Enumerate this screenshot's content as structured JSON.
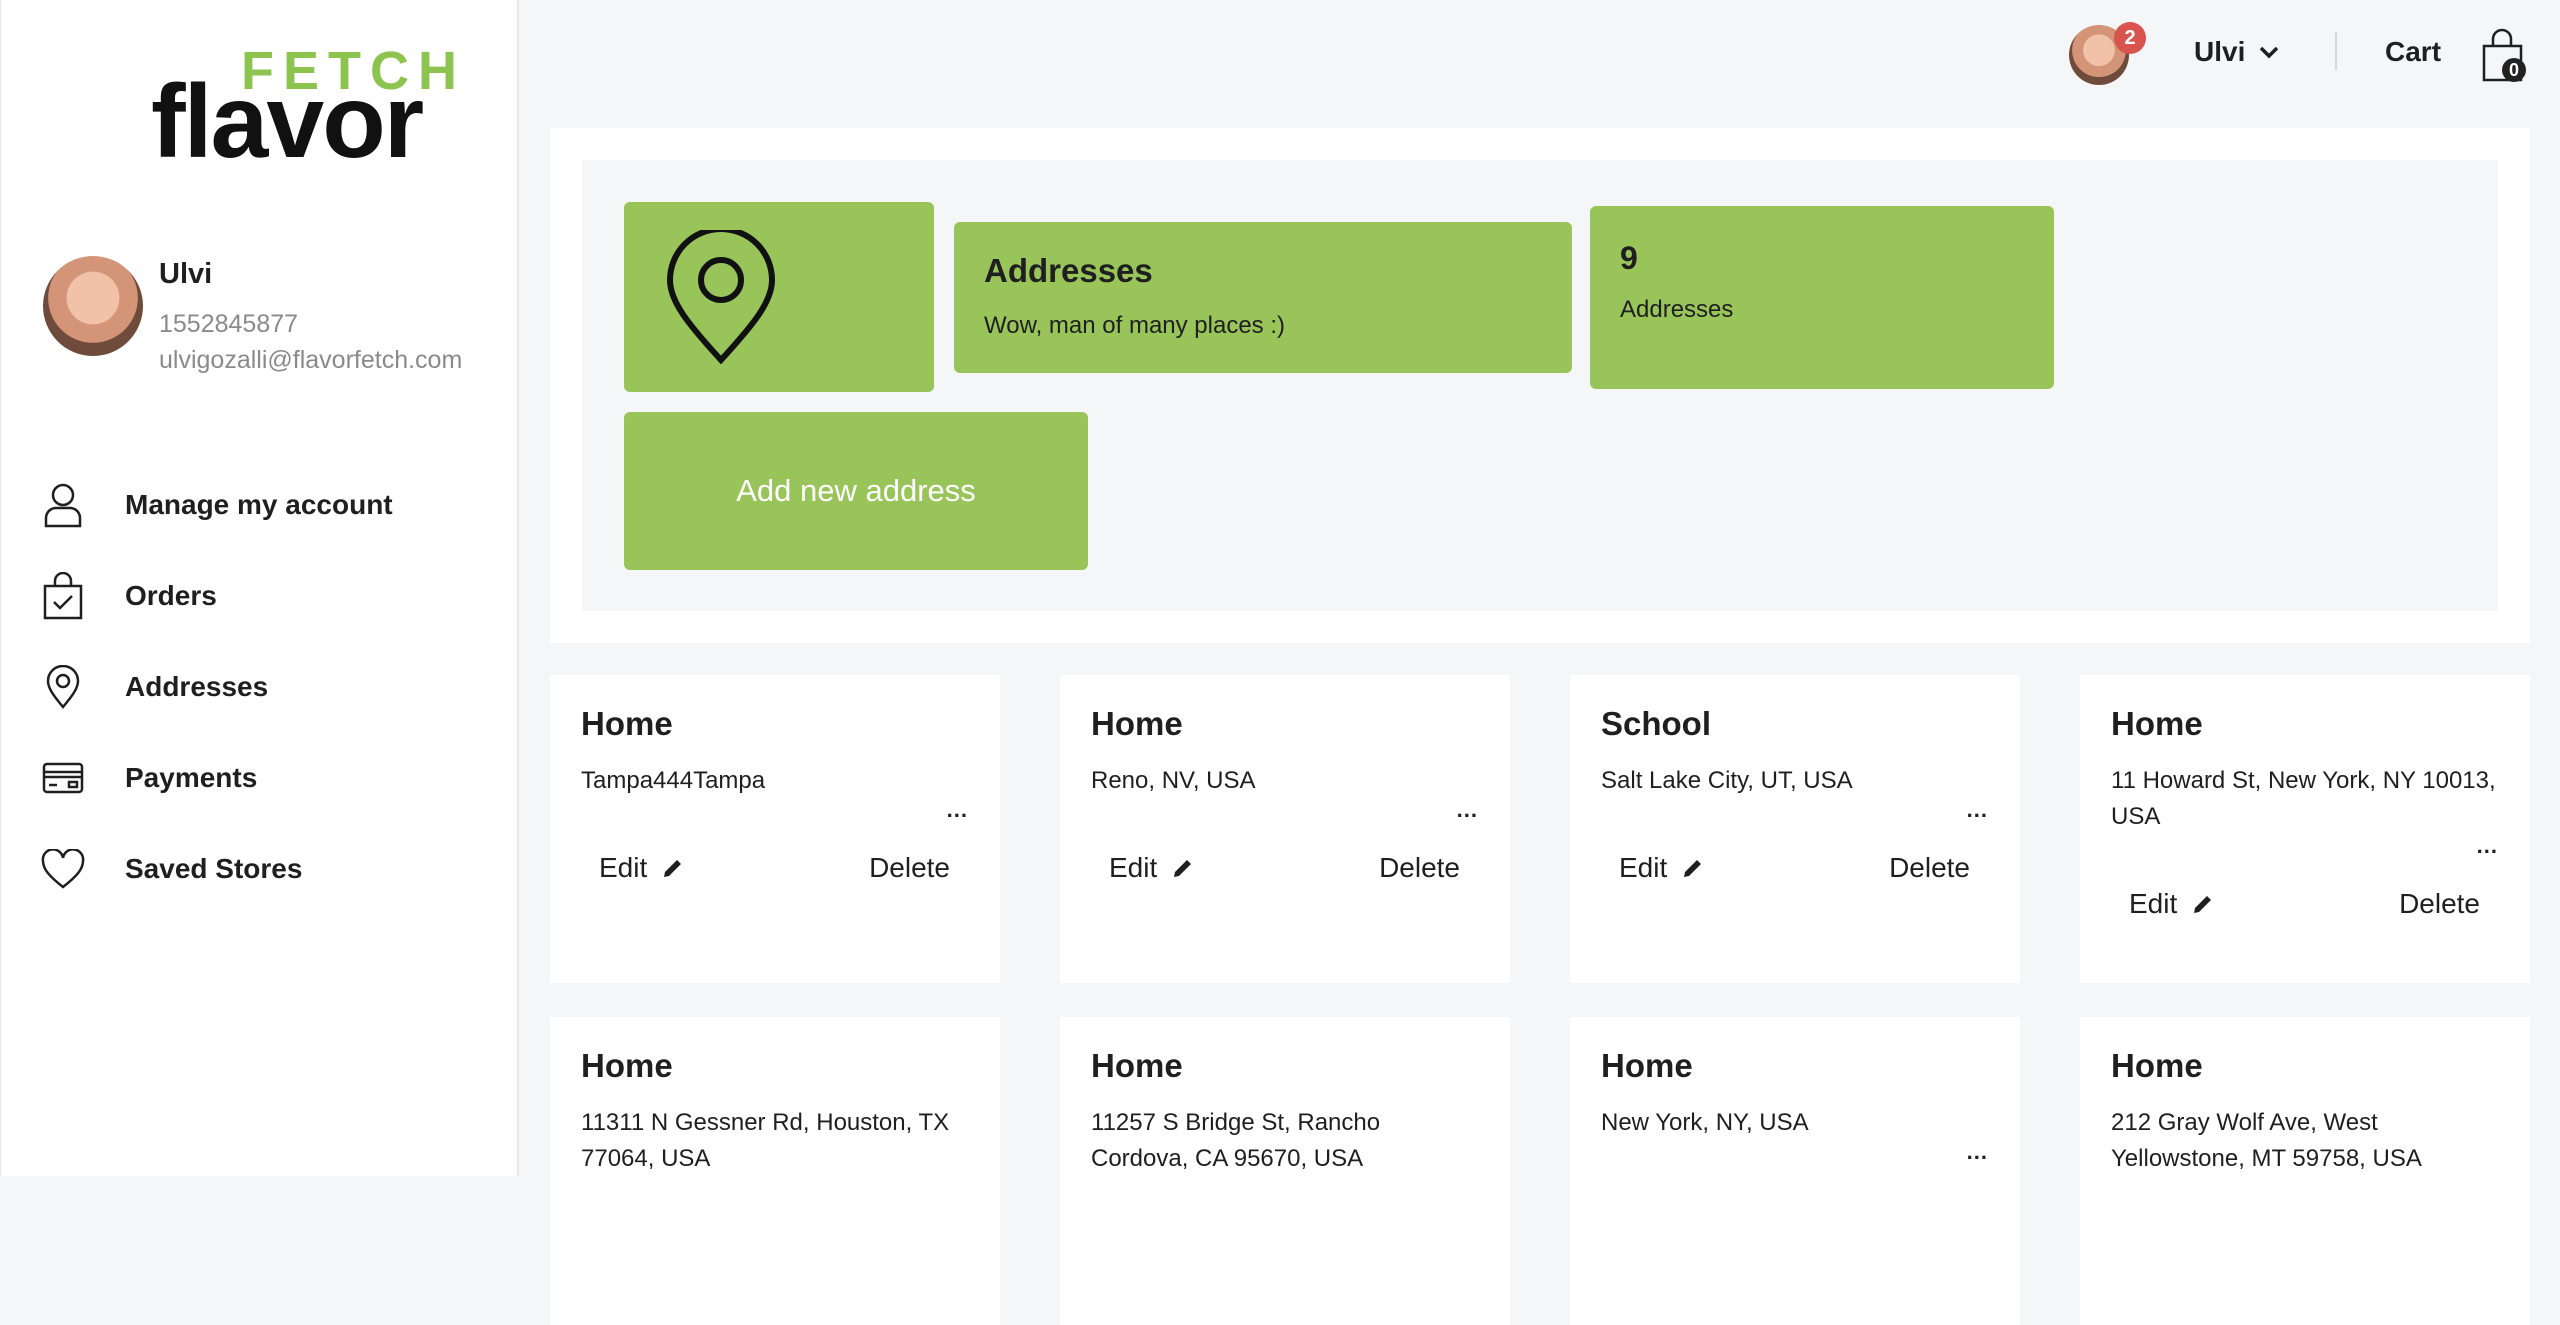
{
  "logo": {
    "top": "FETCH",
    "bottom": "flavor"
  },
  "profile": {
    "name": "Ulvi",
    "phone": "1552845877",
    "email": "ulvigozalli@flavorfetch.com"
  },
  "sidebar": {
    "items": [
      {
        "label": "Manage my account",
        "icon": "user-icon"
      },
      {
        "label": "Orders",
        "icon": "shopping-bag-icon"
      },
      {
        "label": "Addresses",
        "icon": "location-pin-icon"
      },
      {
        "label": "Payments",
        "icon": "credit-card-icon"
      },
      {
        "label": "Saved Stores",
        "icon": "heart-icon"
      }
    ]
  },
  "header": {
    "notification_count": "2",
    "user_name": "Ulvi",
    "cart_label": "Cart",
    "cart_count": "0"
  },
  "summary": {
    "title": "Addresses",
    "subtitle": "Wow, man of many places :)",
    "count": "9",
    "count_label": "Addresses",
    "add_button": "Add new address"
  },
  "addresses": [
    {
      "name": "Home",
      "address": "Tampa444Tampa"
    },
    {
      "name": "Home",
      "address": "Reno, NV, USA"
    },
    {
      "name": "School",
      "address": "Salt Lake City, UT, USA"
    },
    {
      "name": "Home",
      "address": "11 Howard St, New York, NY 10013, USA"
    },
    {
      "name": "Home",
      "address": "11311 N Gessner Rd, Houston, TX 77064, USA"
    },
    {
      "name": "Home",
      "address": "11257 S Bridge St, Rancho Cordova, CA 95670, USA"
    },
    {
      "name": "Home",
      "address": "New York, NY, USA"
    },
    {
      "name": "Home",
      "address": "212 Gray Wolf Ave, West Yellowstone, MT 59758, USA"
    }
  ],
  "card_actions": {
    "more": "...",
    "edit": "Edit",
    "delete": "Delete"
  },
  "colors": {
    "accent": "#98c459",
    "logo_green": "#8dc34f",
    "badge": "#d9534f",
    "background": "#f5f6f8"
  }
}
